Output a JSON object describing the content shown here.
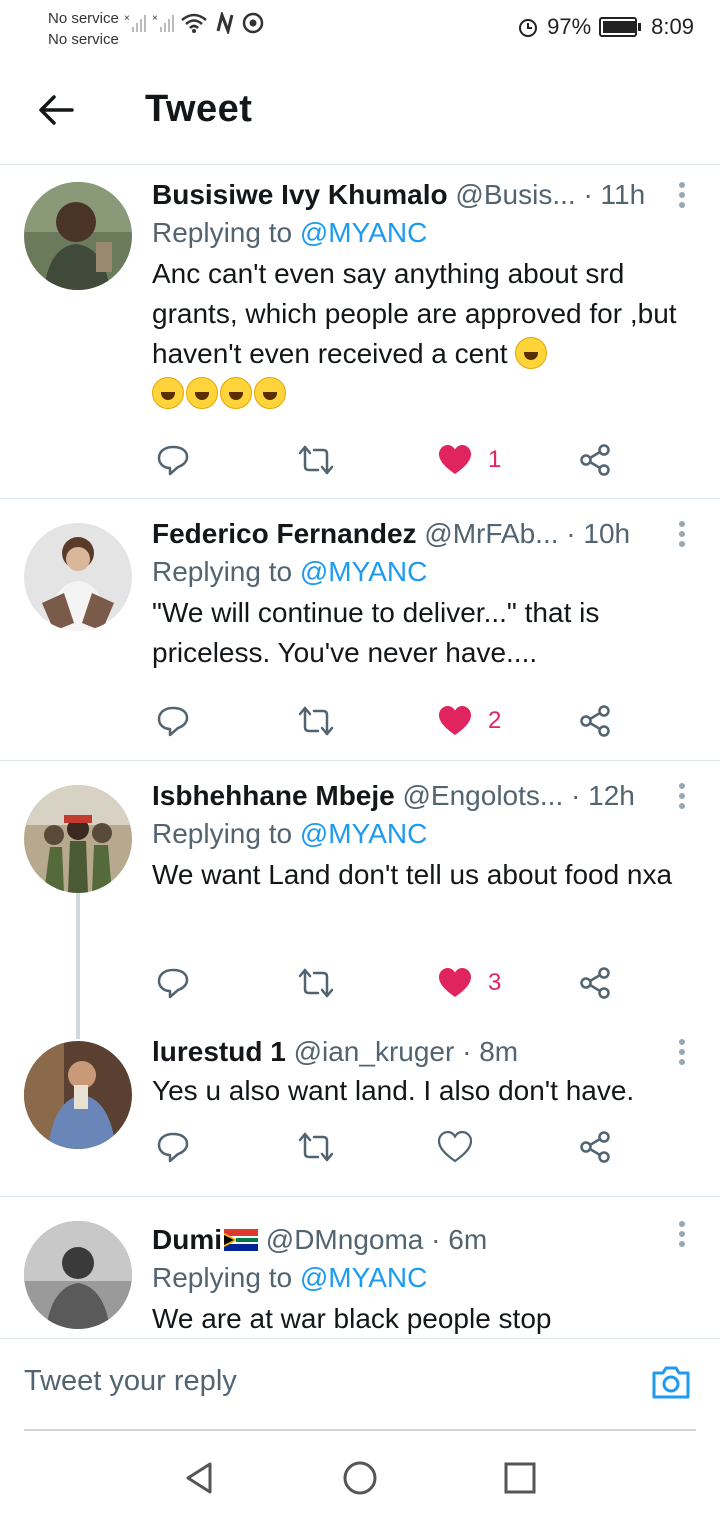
{
  "status_bar": {
    "carrier1": "No service",
    "carrier2": "No service",
    "battery": "97%",
    "battery_level": 0.97,
    "time": "8:09"
  },
  "header": {
    "title": "Tweet"
  },
  "tweets": [
    {
      "name": "Busisiwe Ivy Khumalo",
      "handle": "@Busis...",
      "time": "· 11h",
      "replying_prefix": "Replying to",
      "replying_to": "@MYANC",
      "body": "Anc can't even say anything about srd grants, which people are approved for ,but haven't even received a cent",
      "emoji_count": 5,
      "likes": "1",
      "liked": true
    },
    {
      "name": "Federico Fernandez",
      "handle": "@MrFAb...",
      "time": "· 10h",
      "replying_prefix": "Replying to",
      "replying_to": "@MYANC",
      "body": "\"We will continue to deliver...\" that is priceless. You've never have....",
      "likes": "2",
      "liked": true
    },
    {
      "name": "Isbhehhane Mbeje",
      "handle": "@Engolots...",
      "time": "· 12h",
      "replying_prefix": "Replying to",
      "replying_to": "@MYANC",
      "body": "We want Land don't tell us about food nxa",
      "likes": "3",
      "liked": true
    },
    {
      "name": "lurestud 1",
      "handle": "@ian_kruger",
      "time": "· 8m",
      "body": "Yes u also want land. I also don't have.",
      "likes": "",
      "liked": false
    },
    {
      "name": "Dumi",
      "handle": "@DMngoma",
      "time": "· 6m",
      "replying_prefix": "Replying to",
      "replying_to": "@MYANC",
      "body": "We are at war black people stop"
    }
  ],
  "composer": {
    "placeholder": "Tweet your reply"
  },
  "icons": {
    "reply": "reply-icon",
    "retweet": "retweet-icon",
    "like": "heart-icon",
    "share": "share-icon",
    "camera": "camera-icon"
  },
  "colors": {
    "link": "#1d9bf0",
    "like": "#e0245e",
    "muted": "#536471"
  }
}
